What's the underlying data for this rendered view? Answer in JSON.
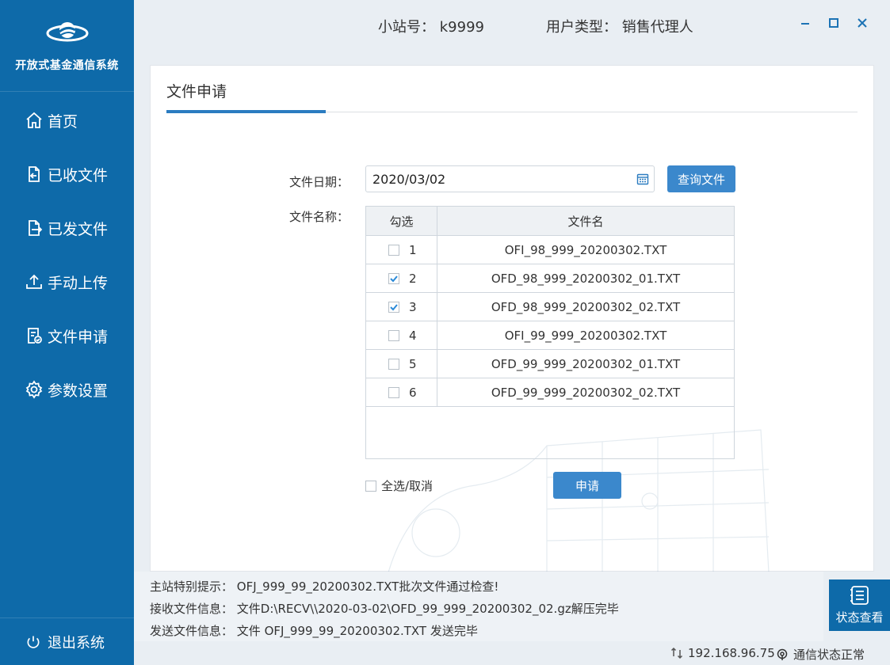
{
  "app": {
    "name": "开放式基金通信系统"
  },
  "header": {
    "station_label": "小站号：",
    "station_value": "k9999",
    "usertype_label": "用户类型：",
    "usertype_value": "销售代理人"
  },
  "sidebar": {
    "items": [
      {
        "label": "首页",
        "icon": "home-icon"
      },
      {
        "label": "已收文件",
        "icon": "file-in-icon"
      },
      {
        "label": "已发文件",
        "icon": "file-out-icon"
      },
      {
        "label": "手动上传",
        "icon": "upload-icon"
      },
      {
        "label": "文件申请",
        "icon": "file-check-icon"
      },
      {
        "label": "参数设置",
        "icon": "gear-icon"
      }
    ],
    "logout": "退出系统"
  },
  "panel": {
    "title": "文件申请",
    "date_label": "文件日期：",
    "date_value": "2020/03/02",
    "query_button": "查询文件",
    "name_label": "文件名称：",
    "columns": [
      "勾选",
      "文件名"
    ],
    "rows": [
      {
        "no": "1",
        "checked": false,
        "name": "OFI_98_999_20200302.TXT"
      },
      {
        "no": "2",
        "checked": true,
        "name": "OFD_98_999_20200302_01.TXT"
      },
      {
        "no": "3",
        "checked": true,
        "name": "OFD_98_999_20200302_02.TXT"
      },
      {
        "no": "4",
        "checked": false,
        "name": "OFI_99_999_20200302.TXT"
      },
      {
        "no": "5",
        "checked": false,
        "name": "OFD_99_999_20200302_01.TXT"
      },
      {
        "no": "6",
        "checked": false,
        "name": "OFD_99_999_20200302_02.TXT"
      }
    ],
    "select_all": "全选/取消",
    "apply_button": "申请"
  },
  "messages": {
    "notice_label": "主站特别提示：",
    "notice_value": "OFJ_999_99_20200302.TXT批次文件通过检查!",
    "recv_label": "接收文件信息：",
    "recv_value": "文件D:\\RECV\\\\2020-03-02\\OFD_99_999_20200302_02.gz解压完毕",
    "send_label": "发送文件信息：",
    "send_value": "文件 OFJ_999_99_20200302.TXT 发送完毕"
  },
  "status_button": "状态查看",
  "statusbar": {
    "ip": "192.168.96.75",
    "connection": "通信状态正常"
  },
  "colors": {
    "sidebar_bg": "#0e6aa9",
    "accent": "#3b88cc",
    "check": "#2b8ad8"
  }
}
